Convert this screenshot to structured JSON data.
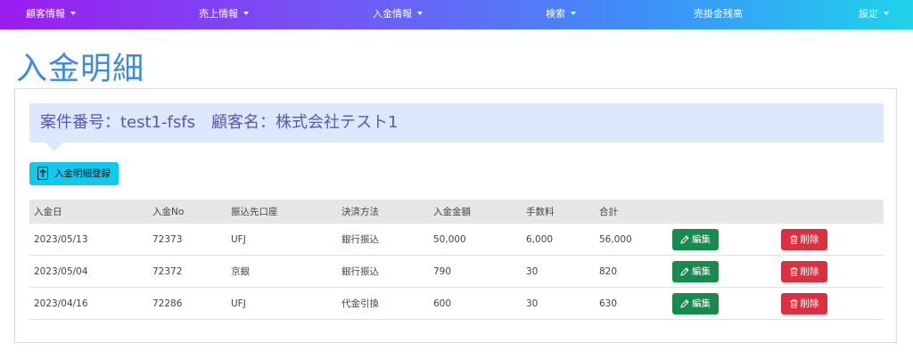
{
  "nav": {
    "items": [
      {
        "label": "顧客情報",
        "caret": true
      },
      {
        "label": "売上情報",
        "caret": true
      },
      {
        "label": "入金情報",
        "caret": true
      },
      {
        "label": "検索",
        "caret": true
      },
      {
        "label": "売掛金残高",
        "caret": false
      },
      {
        "label": "設定",
        "caret": true
      }
    ]
  },
  "page": {
    "title": "入金明細"
  },
  "banner": {
    "text": "案件番号：test1-fsfs　顧客名：株式会社テスト1"
  },
  "actions": {
    "register_label": "入金明細登録",
    "register_icon": "upload-icon"
  },
  "table": {
    "columns": [
      "入金日",
      "入金No",
      "振込先口座",
      "決済方法",
      "入金金額",
      "手数料",
      "合計"
    ],
    "rows": [
      {
        "date": "2023/05/13",
        "no": "72373",
        "account": "UFJ",
        "method": "銀行振込",
        "amount": "50,000",
        "fee": "6,000",
        "total": "56,000"
      },
      {
        "date": "2023/05/04",
        "no": "72372",
        "account": "京銀",
        "method": "銀行振込",
        "amount": "790",
        "fee": "30",
        "total": "820"
      },
      {
        "date": "2023/04/16",
        "no": "72286",
        "account": "UFJ",
        "method": "代金引換",
        "amount": "600",
        "fee": "30",
        "total": "630"
      }
    ],
    "edit_label": "編集",
    "delete_label": "削除"
  },
  "colors": {
    "nav_gradient": [
      "#9b1cf0",
      "#6f5cf6",
      "#3f8ef8",
      "#1fd3ea"
    ],
    "title": "#3d8ae0",
    "banner_bg": "#dce8fb",
    "banner_text": "#5d55b8",
    "register_bg": "#10c9ec",
    "edit_bg": "#178a4d",
    "delete_bg": "#dc3040"
  }
}
